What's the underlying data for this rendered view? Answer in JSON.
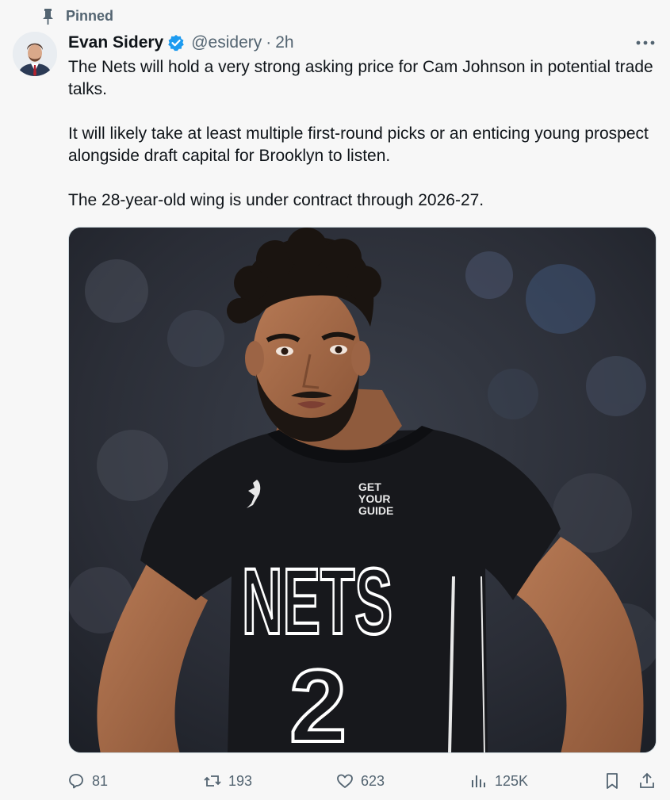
{
  "pinned": {
    "label": "Pinned",
    "icon": "pin-icon"
  },
  "author": {
    "name": "Evan Sidery",
    "handle": "@esidery",
    "separator": "·",
    "time": "2h",
    "verified_icon": "verified-badge-icon",
    "verified_color": "#1d9bf0"
  },
  "body": {
    "paragraphs": [
      "The Nets will hold a very strong asking price for Cam Johnson in potential trade talks.",
      "It will likely take at least multiple first-round picks or an enticing young prospect alongside draft capital for Brooklyn to listen.",
      "The 28-year-old wing is under contract through 2026-27."
    ]
  },
  "media": {
    "jersey_sponsor": [
      "GET",
      "YOUR",
      "GUIDE"
    ],
    "jersey_team": "NETS",
    "jersey_number": "2"
  },
  "actions": {
    "replies": "81",
    "reposts": "193",
    "likes": "623",
    "views": "125K"
  },
  "colors": {
    "secondary_text": "#536471",
    "background": "#f7f7f7",
    "border": "#cfd9de"
  }
}
